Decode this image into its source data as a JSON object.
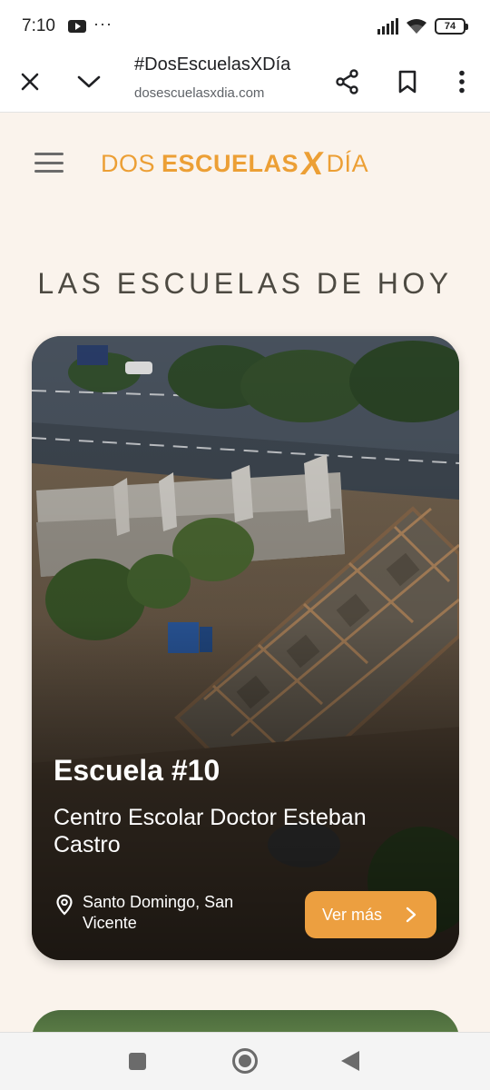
{
  "status_bar": {
    "time": "7:10",
    "battery": "74",
    "notification_icons": [
      "youtube-icon",
      "more-dots-icon"
    ]
  },
  "browser": {
    "title": "#DosEscuelasXDía",
    "url": "dosescuelasxdia.com"
  },
  "site": {
    "logo_dos": "DOS",
    "logo_escuelas": "ESCUELAS",
    "logo_x": "X",
    "logo_dia": "DÍA",
    "section_title": "LAS ESCUELAS DE HOY",
    "brand_color": "#ec9f35"
  },
  "card": {
    "number": "Escuela #10",
    "name": "Centro Escolar Doctor Esteban Castro",
    "location": "Santo Domingo, San Vicente",
    "button_label": "Ver más",
    "button_color": "#ec9f40"
  }
}
